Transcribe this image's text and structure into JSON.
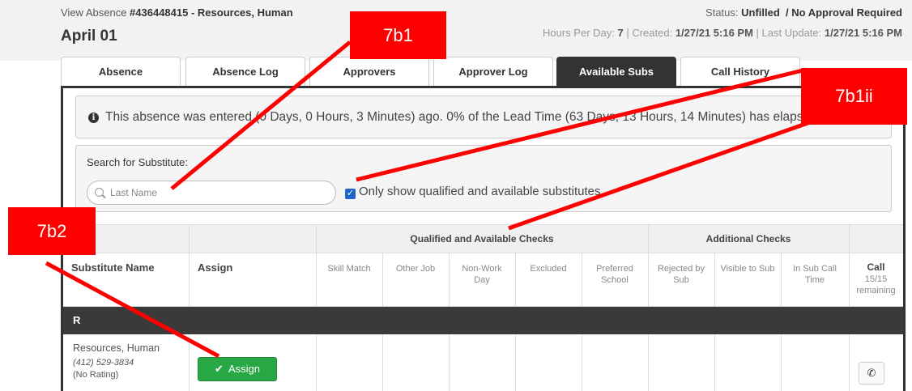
{
  "header": {
    "view_prefix": "View Absence ",
    "absence_id": "#436448415 - Resources, Human",
    "date": "April 01",
    "status_label": "Status: ",
    "status_value": "Unfilled",
    "approval": "/ No Approval Required",
    "hours_label": "Hours Per Day: ",
    "hours_value": "7",
    "created_label": " | Created: ",
    "created_value": "1/27/21 5:16 PM",
    "updated_label": " | Last Update: ",
    "updated_value": "1/27/21 5:16 PM"
  },
  "tabs": [
    {
      "label": "Absence"
    },
    {
      "label": "Absence Log"
    },
    {
      "label": "Approvers"
    },
    {
      "label": "Approver Log"
    },
    {
      "label": "Available Subs",
      "active": true
    },
    {
      "label": "Call History"
    }
  ],
  "info": {
    "icon": "info-circle-icon",
    "text": "This absence was entered (0 Days, 0 Hours, 3 Minutes) ago. 0% of the Lead Time (63 Days, 13 Hours, 14 Minutes) has elapsed."
  },
  "search": {
    "label": "Search for Substitute:",
    "placeholder": "Last Name",
    "value": "",
    "checkbox_label": "Only show qualified and available substitutes",
    "checkbox_checked": true
  },
  "grid": {
    "group_qualified": "Qualified and Available Checks",
    "group_additional": "Additional Checks",
    "col_name": "Substitute Name",
    "col_assign": "Assign",
    "col_skill": "Skill Match",
    "col_other_job": "Other Job",
    "col_nonwork_1": "Non-Work",
    "col_nonwork_2": "Day",
    "col_excluded": "Excluded",
    "col_preferred_1": "Preferred",
    "col_preferred_2": "School",
    "col_rejected_1": "Rejected by",
    "col_rejected_2": "Sub",
    "col_visible": "Visible to Sub",
    "col_insub_1": "In Sub Call",
    "col_insub_2": "Time",
    "col_call": "Call",
    "col_call_count": "15/15",
    "col_call_remaining": "remaining",
    "group_letter": "R",
    "rows": [
      {
        "name": "Resources, Human",
        "phone": "(412) 529-3834",
        "rating": "(No Rating)",
        "assign_label": "Assign",
        "call_icon": "phone-icon"
      }
    ]
  },
  "annotations": {
    "a1": "7b1",
    "a2": "7b1ii",
    "a3": "7b2",
    "color": "#ff0000"
  }
}
